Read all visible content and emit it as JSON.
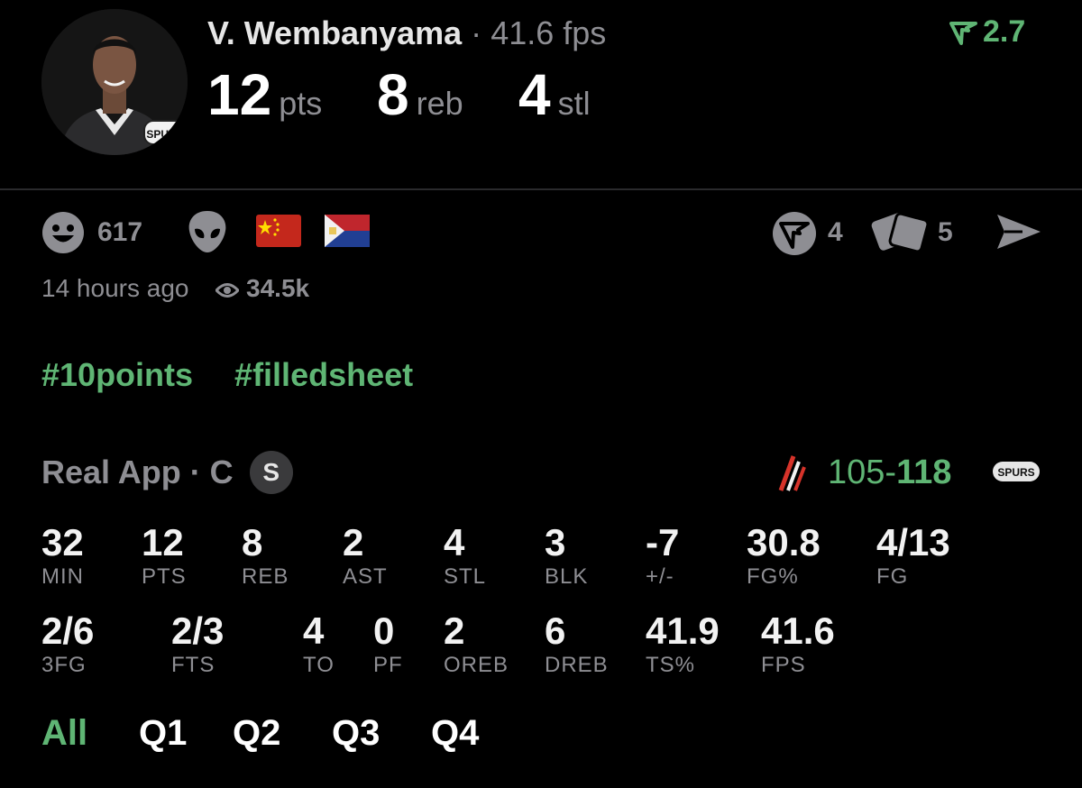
{
  "header": {
    "player_name": "V. Wembanyama",
    "separator": "·",
    "fps": "41.6 fps",
    "rating": "2.7",
    "avatar_team_logo": "SPURS",
    "big_stats": [
      {
        "value": "12",
        "unit": "pts"
      },
      {
        "value": "8",
        "unit": "reb"
      },
      {
        "value": "4",
        "unit": "stl"
      }
    ]
  },
  "social": {
    "reactions_count": "617",
    "tokens_count": "4",
    "cards_count": "5",
    "time_ago": "14 hours ago",
    "views": "34.5k"
  },
  "hashtags": [
    "#10points",
    "#filledsheet"
  ],
  "game": {
    "app_line": "Real App · C",
    "badge": "S",
    "score_left": "105-",
    "score_right": "118",
    "opponent_logo": "trail-blazers-logo",
    "team_logo_text": "SPURS"
  },
  "stats_row1": [
    {
      "value": "32",
      "label": "MIN"
    },
    {
      "value": "12",
      "label": "PTS"
    },
    {
      "value": "8",
      "label": "REB"
    },
    {
      "value": "2",
      "label": "AST"
    },
    {
      "value": "4",
      "label": "STL"
    },
    {
      "value": "3",
      "label": "BLK"
    },
    {
      "value": "-7",
      "label": "+/-"
    },
    {
      "value": "30.8",
      "label": "FG%"
    },
    {
      "value": "4/13",
      "label": "FG"
    }
  ],
  "stats_row2": [
    {
      "value": "2/6",
      "label": "3FG"
    },
    {
      "value": "2/3",
      "label": "FTS"
    },
    {
      "value": "4",
      "label": "TO"
    },
    {
      "value": "0",
      "label": "PF"
    },
    {
      "value": "2",
      "label": "OREB"
    },
    {
      "value": "6",
      "label": "DREB"
    },
    {
      "value": "41.9",
      "label": "TS%"
    },
    {
      "value": "41.6",
      "label": "FPS"
    }
  ],
  "tabs": [
    "All",
    "Q1",
    "Q2",
    "Q3",
    "Q4"
  ],
  "colors": {
    "accent_green": "#5fb574",
    "negative_red": "#e0443a",
    "muted": "#8e8e93"
  }
}
